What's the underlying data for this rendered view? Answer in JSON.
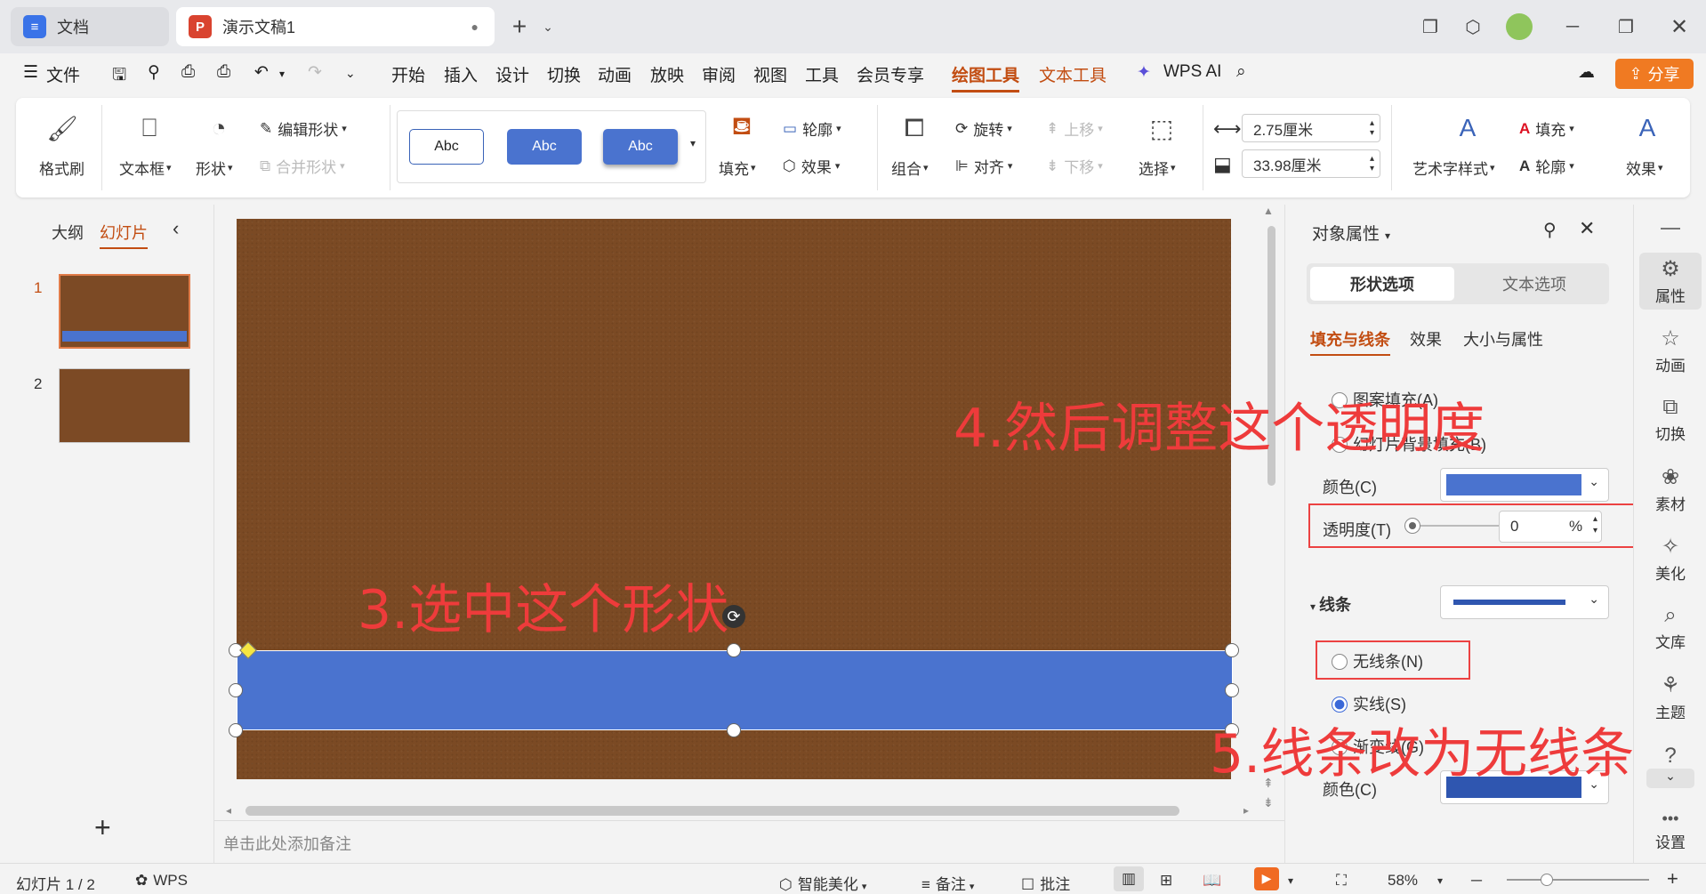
{
  "tabs": {
    "doc": "文档",
    "ppt": "演示文稿1",
    "doc_icon": "doc-icon",
    "ppt_icon": "P"
  },
  "menu": {
    "file": "文件",
    "items": [
      "开始",
      "插入",
      "设计",
      "切换",
      "动画",
      "放映",
      "审阅",
      "视图",
      "工具",
      "会员专享",
      "绘图工具",
      "文本工具"
    ],
    "wps_ai": "WPS AI",
    "share": "分享"
  },
  "ribbon": {
    "format_painter": "格式刷",
    "textbox": "文本框",
    "shape": "形状",
    "edit_shape": "编辑形状",
    "merge_shape": "合并形状",
    "styles": [
      "Abc",
      "Abc",
      "Abc"
    ],
    "fill": "填充",
    "outline": "轮廓",
    "effect": "效果",
    "group": "组合",
    "rotate": "旋转",
    "align": "对齐",
    "move_up": "上移",
    "move_down": "下移",
    "select": "选择",
    "height": "2.75厘米",
    "width": "33.98厘米",
    "art_style": "艺术字样式",
    "text_fill": "填充",
    "text_outline": "轮廓",
    "text_effect": "效果"
  },
  "left_panel": {
    "outline": "大纲",
    "slides": "幻灯片",
    "slide_numbers": [
      "1",
      "2"
    ],
    "add": "+"
  },
  "annotations": {
    "a3": "3.选中这个形状",
    "a4": "4.然后调整这个透明度",
    "a5": "5.线条改为无线条"
  },
  "notes_placeholder": "单击此处添加备注",
  "props": {
    "title": "对象属性",
    "tab_shape": "形状选项",
    "tab_text": "文本选项",
    "sub_fill_line": "填充与线条",
    "sub_effect": "效果",
    "sub_size": "大小与属性",
    "pattern_fill": "图案填充(A)",
    "slide_bg_fill": "幻灯片背景填充(B)",
    "color_label": "颜色(C)",
    "transparency_label": "透明度(T)",
    "transparency_value": "0",
    "percent": "%",
    "line_section": "线条",
    "no_line": "无线条(N)",
    "solid_line": "实线(S)",
    "gradient_line": "渐变线(G)",
    "line_color_label": "颜色(C)",
    "fill_color": "#4a73cf",
    "line_color": "#2f56b0"
  },
  "right_sidebar": {
    "items": [
      "属性",
      "动画",
      "切换",
      "素材",
      "美化",
      "文库",
      "主题"
    ],
    "settings": "设置"
  },
  "status": {
    "slide_count": "幻灯片 1 / 2",
    "wps": "WPS",
    "beautify": "智能美化",
    "notes": "备注",
    "comments": "批注",
    "zoom": "58%"
  }
}
